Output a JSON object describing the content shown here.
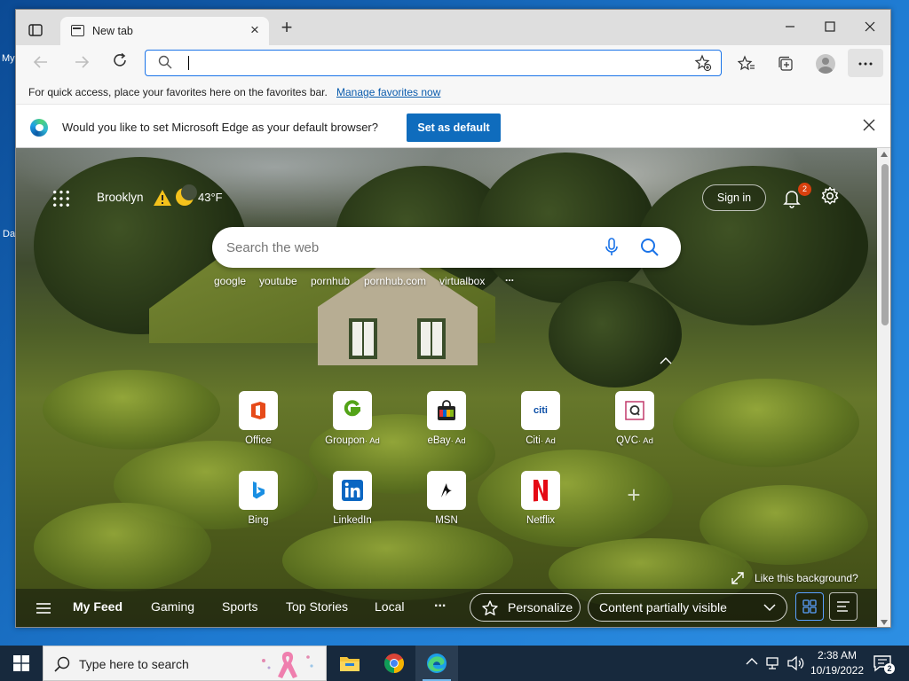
{
  "desktop": {
    "fragment_1": "My",
    "fragment_2": "Da"
  },
  "browser": {
    "tab": {
      "title": "New tab"
    },
    "address_bar": {
      "value": "",
      "placeholder": ""
    },
    "favorites_bar": {
      "message": "For quick access, place your favorites here on the favorites bar.",
      "link": "Manage favorites now"
    },
    "infobar": {
      "message": "Would you like to set Microsoft Edge as your default browser?",
      "button": "Set as default"
    }
  },
  "ntp": {
    "location": "Brooklyn",
    "temperature": "43°F",
    "sign_in": "Sign in",
    "notification_count": "2",
    "search_placeholder": "Search the web",
    "trending": [
      "google",
      "youtube",
      "pornhub",
      "pornhub.com",
      "virtualbox",
      "..."
    ],
    "tiles": [
      {
        "label": "Office",
        "ad": "",
        "icon": "office-icon",
        "color": "#e64a19"
      },
      {
        "label": "Groupon",
        "ad": "· Ad",
        "icon": "groupon-icon",
        "color": "#53a318"
      },
      {
        "label": "eBay",
        "ad": "· Ad",
        "icon": "ebay-icon",
        "color": "#e53238"
      },
      {
        "label": "Citi",
        "ad": "· Ad",
        "icon": "citi-icon",
        "color": "#0a4ea6"
      },
      {
        "label": "QVC",
        "ad": "· Ad",
        "icon": "qvc-icon",
        "color": "#333333"
      },
      {
        "label": "Bing",
        "ad": "",
        "icon": "bing-icon",
        "color": "#1a8fe3"
      },
      {
        "label": "LinkedIn",
        "ad": "",
        "icon": "linkedin-icon",
        "color": "#0a66c2"
      },
      {
        "label": "MSN",
        "ad": "",
        "icon": "msn-icon",
        "color": "#111111"
      },
      {
        "label": "Netflix",
        "ad": "",
        "icon": "netflix-icon",
        "color": "#e50914"
      }
    ],
    "citi_mark": "citi",
    "like_background": "Like this background?",
    "feed": {
      "tabs": [
        "My Feed",
        "Gaming",
        "Sports",
        "Top Stories",
        "Local"
      ],
      "more": "...",
      "personalize": "Personalize",
      "content_visibility": "Content partially visible"
    }
  },
  "taskbar": {
    "search_placeholder": "Type here to search",
    "time": "2:38 AM",
    "date": "10/19/2022",
    "notification_count": "2"
  },
  "colors": {
    "accent": "#0f6cbd",
    "taskbar": "#17293d",
    "notification_badge": "#d9400e"
  }
}
